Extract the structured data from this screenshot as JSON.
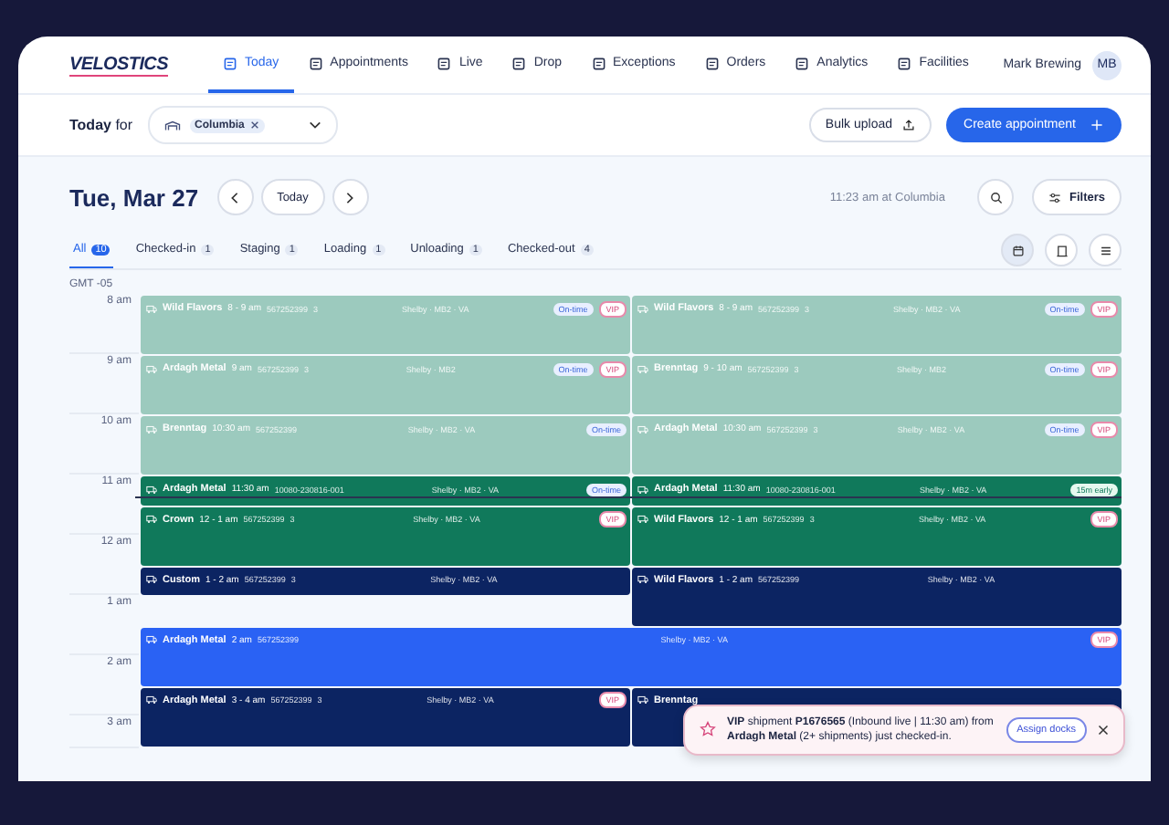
{
  "logo": "VELOSTICS",
  "nav": [
    {
      "label": "Today",
      "selected": true
    },
    {
      "label": "Appointments",
      "selected": false
    },
    {
      "label": "Live",
      "selected": false
    },
    {
      "label": "Drop",
      "selected": false
    },
    {
      "label": "Exceptions",
      "selected": false
    },
    {
      "label": "Orders",
      "selected": false
    },
    {
      "label": "Analytics",
      "selected": false
    },
    {
      "label": "Facilities",
      "selected": false
    }
  ],
  "user": {
    "name": "Mark Brewing",
    "initials": "MB"
  },
  "toolbar": {
    "label": "Today",
    "label_suffix": "for",
    "facility_chip": "Columbia",
    "bulk_upload": "Bulk upload",
    "create": "Create appointment"
  },
  "date_header": {
    "date": "Tue, Mar 27",
    "today_button": "Today",
    "clock": "11:23 am at Columbia",
    "filters": "Filters"
  },
  "status_tabs": [
    {
      "label": "All",
      "count": "10",
      "selected": true
    },
    {
      "label": "Checked-in",
      "count": "1",
      "selected": false
    },
    {
      "label": "Staging",
      "count": "1",
      "selected": false
    },
    {
      "label": "Loading",
      "count": "1",
      "selected": false
    },
    {
      "label": "Unloading",
      "count": "1",
      "selected": false
    },
    {
      "label": "Checked-out",
      "count": "4",
      "selected": false
    }
  ],
  "views": [
    {
      "selected": true
    },
    {
      "selected": false
    },
    {
      "selected": false
    }
  ],
  "calendar": {
    "timezone": "GMT -05",
    "hours": [
      "8 am",
      "9 am",
      "10 am",
      "11 am",
      "12 am",
      "1 am",
      "2 am",
      "3 am"
    ],
    "columns": [
      {
        "events": [
          {
            "kind": "done",
            "name": "Wild Flavors",
            "time": "8 - 9 am",
            "ref": "567252399",
            "count": "3",
            "location": "Shelby · MB2 · VA",
            "badges": [
              {
                "kind": "ontime",
                "label": "On-time"
              },
              {
                "kind": "vip",
                "label": "VIP"
              }
            ]
          },
          {
            "kind": "done",
            "name": "Ardagh Metal",
            "time": "9 am",
            "ref": "567252399",
            "count": "3",
            "location": "Shelby · MB2",
            "badges": [
              {
                "kind": "ontime",
                "label": "On-time"
              },
              {
                "kind": "vip",
                "label": "VIP"
              }
            ]
          },
          {
            "kind": "done",
            "name": "Brenntag",
            "time": "10:30 am",
            "ref": "567252399",
            "location": "Shelby · MB2 · VA",
            "badges": [
              {
                "kind": "ontime",
                "label": "On-time"
              }
            ]
          },
          {
            "kind": "active",
            "name": "Ardagh Metal",
            "time": "11:30 am",
            "ref": "10080-230816-001",
            "location": "Shelby · MB2 · VA",
            "badges": [
              {
                "kind": "ontime",
                "label": "On-time"
              }
            ]
          },
          {
            "kind": "active",
            "name": "Crown",
            "time": "12 - 1 am",
            "ref": "567252399",
            "count": "3",
            "location": "Shelby · MB2 · VA",
            "badges": [
              {
                "kind": "vip",
                "label": "VIP"
              }
            ]
          },
          {
            "kind": "planned",
            "name": "Custom",
            "time": "1 - 2 am",
            "ref": "567252399",
            "count": "3",
            "location": "Shelby · MB2 · VA"
          },
          {
            "kind": "planned",
            "name": "Ardagh Metal",
            "time": "3 - 4 am",
            "ref": "567252399",
            "count": "3",
            "location": "Shelby · MB2 · VA",
            "badges": [
              {
                "kind": "vip",
                "label": "VIP"
              }
            ]
          }
        ]
      },
      {
        "events": [
          {
            "kind": "done",
            "name": "Wild Flavors",
            "time": "8 - 9 am",
            "ref": "567252399",
            "count": "3",
            "location": "Shelby · MB2 · VA",
            "badges": [
              {
                "kind": "ontime",
                "label": "On-time"
              },
              {
                "kind": "vip",
                "label": "VIP"
              }
            ]
          },
          {
            "kind": "done",
            "name": "Brenntag",
            "time": "9 - 10 am",
            "ref": "567252399",
            "count": "3",
            "location": "Shelby · MB2",
            "badges": [
              {
                "kind": "ontime",
                "label": "On-time"
              },
              {
                "kind": "vip",
                "label": "VIP"
              }
            ]
          },
          {
            "kind": "done",
            "name": "Ardagh Metal",
            "time": "10:30 am",
            "ref": "567252399",
            "count": "3",
            "location": "Shelby · MB2 · VA",
            "badges": [
              {
                "kind": "ontime",
                "label": "On-time"
              },
              {
                "kind": "vip",
                "label": "VIP"
              }
            ]
          },
          {
            "kind": "active",
            "name": "Ardagh Metal",
            "time": "11:30 am",
            "ref": "10080-230816-001",
            "location": "Shelby · MB2 · VA",
            "badges": [
              {
                "kind": "early",
                "label": "15m early"
              }
            ]
          },
          {
            "kind": "active",
            "name": "Wild Flavors",
            "time": "12 - 1 am",
            "ref": "567252399",
            "count": "3",
            "location": "Shelby · MB2 · VA",
            "badges": [
              {
                "kind": "vip",
                "label": "VIP"
              }
            ]
          },
          {
            "kind": "planned",
            "name": "Wild Flavors",
            "time": "1 - 2 am",
            "ref": "567252399",
            "location": "Shelby · MB2 · VA"
          },
          {
            "kind": "planned",
            "name": "Brenntag"
          }
        ]
      }
    ],
    "wide_events": [
      {
        "kind": "arrived",
        "name": "Ardagh Metal",
        "time": "2 am",
        "ref": "567252399",
        "location": "Shelby · MB2 · VA",
        "badges": [
          {
            "kind": "vip",
            "label": "VIP"
          }
        ]
      }
    ]
  },
  "toast": {
    "message": "**VIP** shipment **P1676565** (Inbound live | 11:30 am) from **Ardagh Metal** (2+ shipments) just checked-in.",
    "action": "Assign docks"
  }
}
